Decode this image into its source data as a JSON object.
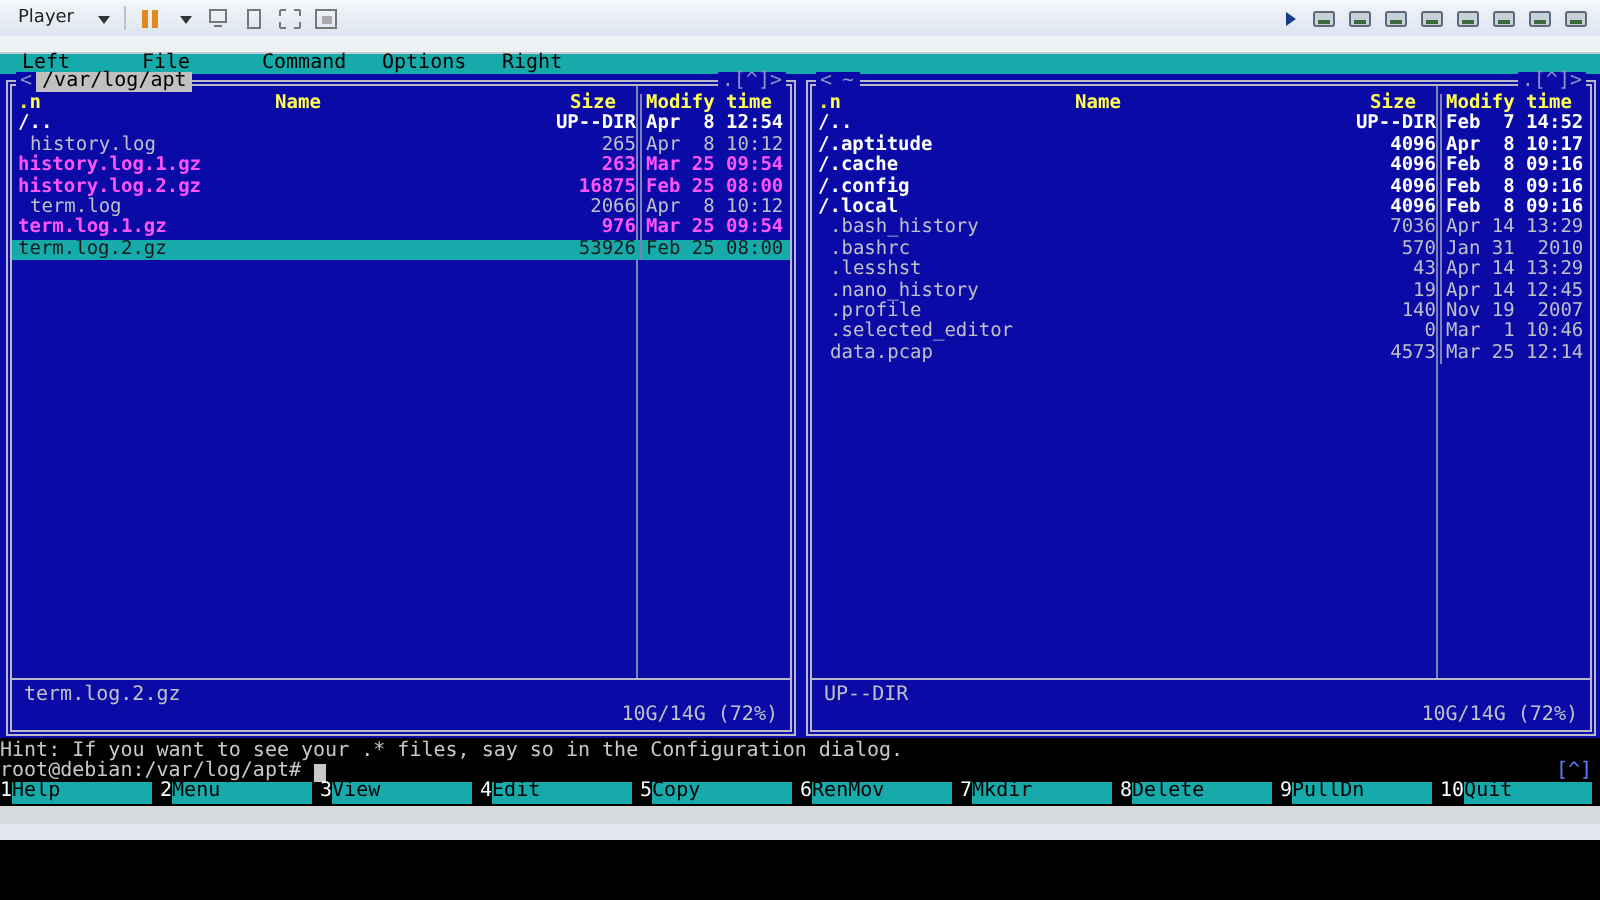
{
  "player": {
    "label": "Player"
  },
  "menubar": [
    "Left",
    "File",
    "Command",
    "Options",
    "Right"
  ],
  "panels": [
    {
      "arrow": "<",
      "path": "/var/log/apt",
      "active": true,
      "corner": ".[^]>",
      "columns": [
        ".n",
        "Name",
        "Size",
        "Modify time"
      ],
      "files": [
        {
          "name": "/..",
          "size": "UP--DIR",
          "time": "Apr  8 12:54",
          "kind": "updir",
          "selected": false
        },
        {
          "name": "history.log",
          "size": "265",
          "time": "Apr  8 10:12",
          "kind": "file",
          "selected": false
        },
        {
          "name": "history.log.1.gz",
          "size": "263",
          "time": "Mar 25 09:54",
          "kind": "archive",
          "selected": false
        },
        {
          "name": "history.log.2.gz",
          "size": "16875",
          "time": "Feb 25 08:00",
          "kind": "archive",
          "selected": false
        },
        {
          "name": "term.log",
          "size": "2066",
          "time": "Apr  8 10:12",
          "kind": "file",
          "selected": false
        },
        {
          "name": "term.log.1.gz",
          "size": "976",
          "time": "Mar 25 09:54",
          "kind": "archive",
          "selected": false
        },
        {
          "name": "term.log.2.gz",
          "size": "53926",
          "time": "Feb 25 08:00",
          "kind": "archive",
          "selected": true
        }
      ],
      "status": "term.log.2.gz",
      "disk": "10G/14G (72%)"
    },
    {
      "arrow": "<",
      "path": "~",
      "active": false,
      "corner": ".[^]>",
      "columns": [
        ".n",
        "Name",
        "Size",
        "Modify time"
      ],
      "files": [
        {
          "name": "/..",
          "size": "UP--DIR",
          "time": "Feb  7 14:52",
          "kind": "updir",
          "selected": false
        },
        {
          "name": "/.aptitude",
          "size": "4096",
          "time": "Apr  8 10:17",
          "kind": "dir",
          "selected": false
        },
        {
          "name": "/.cache",
          "size": "4096",
          "time": "Feb  8 09:16",
          "kind": "dir",
          "selected": false
        },
        {
          "name": "/.config",
          "size": "4096",
          "time": "Feb  8 09:16",
          "kind": "dir",
          "selected": false
        },
        {
          "name": "/.local",
          "size": "4096",
          "time": "Feb  8 09:16",
          "kind": "dir",
          "selected": false
        },
        {
          "name": ".bash_history",
          "size": "7036",
          "time": "Apr 14 13:29",
          "kind": "file",
          "selected": false
        },
        {
          "name": ".bashrc",
          "size": "570",
          "time": "Jan 31  2010",
          "kind": "file",
          "selected": false
        },
        {
          "name": ".lesshst",
          "size": "43",
          "time": "Apr 14 13:29",
          "kind": "file",
          "selected": false
        },
        {
          "name": ".nano_history",
          "size": "19",
          "time": "Apr 14 12:45",
          "kind": "file",
          "selected": false
        },
        {
          "name": ".profile",
          "size": "140",
          "time": "Nov 19  2007",
          "kind": "file",
          "selected": false
        },
        {
          "name": ".selected_editor",
          "size": "0",
          "time": "Mar  1 10:46",
          "kind": "file",
          "selected": false
        },
        {
          "name": "data.pcap",
          "size": "4573",
          "time": "Mar 25 12:14",
          "kind": "file",
          "selected": false
        }
      ],
      "status": "UP--DIR",
      "disk": "10G/14G (72%)"
    }
  ],
  "hint": "Hint: If you want to see your .* files, say so in the Configuration dialog.",
  "prompt": "root@debian:/var/log/apt#",
  "corner": "[^]",
  "fkeys": [
    {
      "num": "1",
      "label": "Help"
    },
    {
      "num": "2",
      "label": "Menu"
    },
    {
      "num": "3",
      "label": "View"
    },
    {
      "num": "4",
      "label": "Edit"
    },
    {
      "num": "5",
      "label": "Copy"
    },
    {
      "num": "6",
      "label": "RenMov"
    },
    {
      "num": "7",
      "label": "Mkdir"
    },
    {
      "num": "8",
      "label": "Delete"
    },
    {
      "num": "9",
      "label": "PullDn"
    },
    {
      "num": "10",
      "label": "Quit"
    }
  ]
}
